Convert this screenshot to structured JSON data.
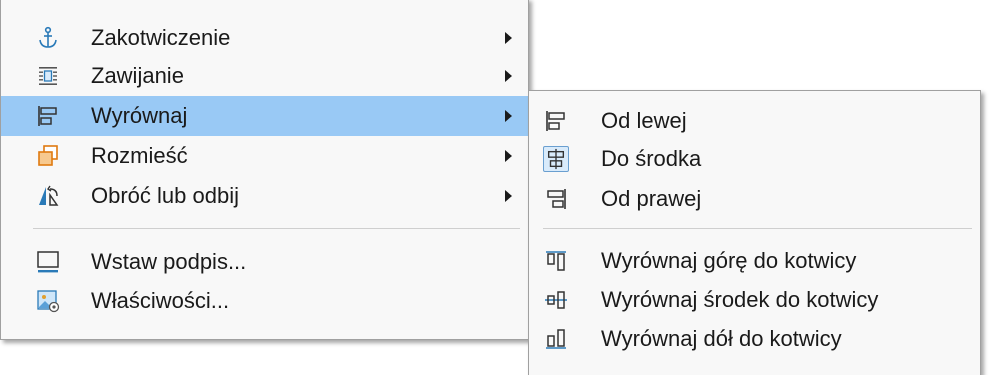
{
  "main_menu": {
    "items": [
      {
        "label": "Zakotwiczenie",
        "icon": "anchor-icon",
        "has_submenu": true
      },
      {
        "label": "Zawijanie",
        "icon": "wrap-icon",
        "has_submenu": true
      },
      {
        "label": "Wyrównaj",
        "icon": "align-icon",
        "has_submenu": true,
        "highlighted": true
      },
      {
        "label": "Rozmieść",
        "icon": "arrange-icon",
        "has_submenu": true
      },
      {
        "label": "Obróć lub odbij",
        "icon": "rotate-flip-icon",
        "has_submenu": true
      },
      {
        "label": "Wstaw podpis...",
        "icon": "caption-icon",
        "has_submenu": false
      },
      {
        "label": "Właściwości...",
        "icon": "properties-icon",
        "has_submenu": false
      }
    ]
  },
  "sub_menu": {
    "items": [
      {
        "label": "Od lewej",
        "icon": "align-left-icon"
      },
      {
        "label": "Do środka",
        "icon": "align-center-icon",
        "checked": true
      },
      {
        "label": "Od prawej",
        "icon": "align-right-icon"
      },
      {
        "label": "Wyrównaj górę do kotwicy",
        "icon": "align-top-anchor-icon"
      },
      {
        "label": "Wyrównaj środek do kotwicy",
        "icon": "align-middle-anchor-icon"
      },
      {
        "label": "Wyrównaj dół do kotwicy",
        "icon": "align-bottom-anchor-icon"
      }
    ]
  },
  "colors": {
    "highlight": "#99c9f5",
    "menu_bg": "#f8f8f8",
    "icon_blue": "#2a7ab8",
    "icon_orange": "#e07a10"
  }
}
